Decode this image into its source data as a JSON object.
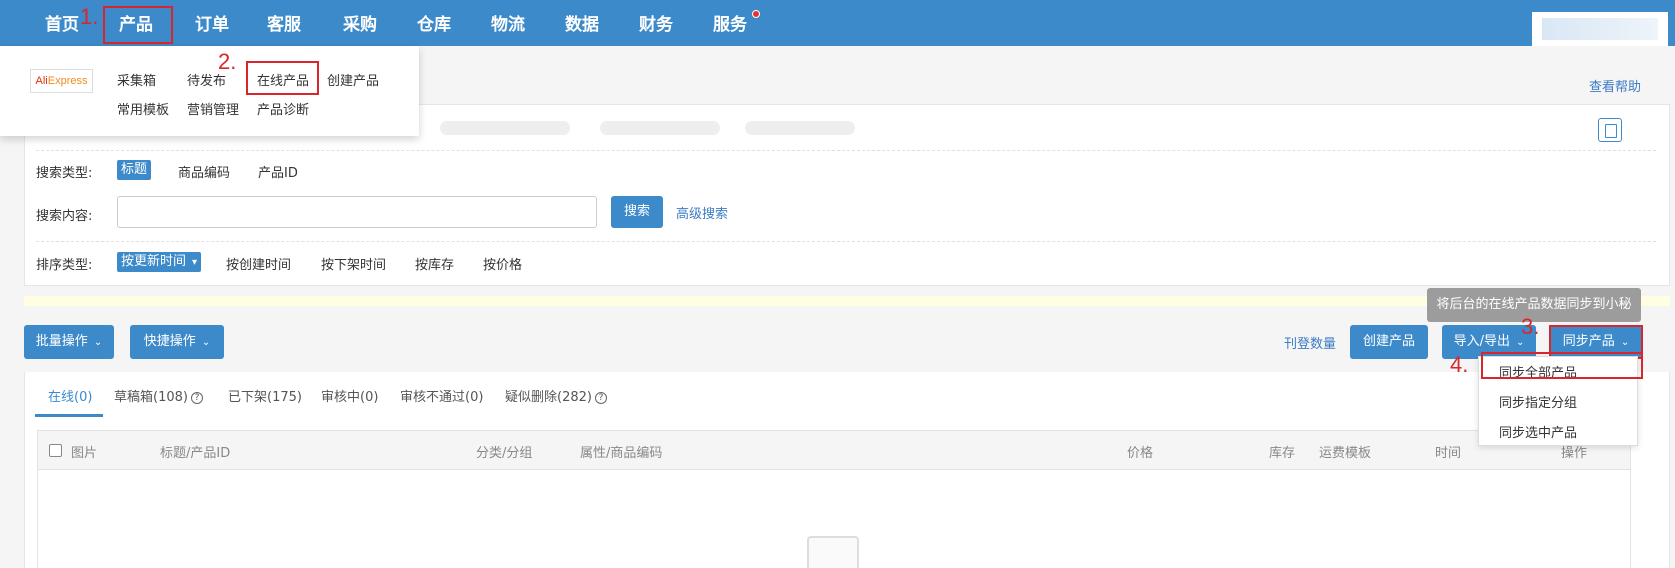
{
  "nav": {
    "items": [
      {
        "label": "首页"
      },
      {
        "label": "产品"
      },
      {
        "label": "订单"
      },
      {
        "label": "客服"
      },
      {
        "label": "采购"
      },
      {
        "label": "仓库"
      },
      {
        "label": "物流"
      },
      {
        "label": "数据"
      },
      {
        "label": "财务"
      },
      {
        "label": "服务"
      }
    ]
  },
  "steps": {
    "s1": "1.",
    "s2": "2.",
    "s3": "3.",
    "s4": "4."
  },
  "product_menu": {
    "logo_ali": "Ali",
    "logo_express": "Express",
    "row1": [
      "采集箱",
      "待发布",
      "在线产品",
      "创建产品"
    ],
    "row2": [
      "常用模板",
      "营销管理",
      "产品诊断"
    ]
  },
  "help_link": "查看帮助",
  "search": {
    "type_label": "搜索类型:",
    "type_options": [
      "标题",
      "商品编码",
      "产品ID"
    ],
    "content_label": "搜索内容:",
    "input_value": "",
    "search_button": "搜索",
    "advanced_link": "高级搜索",
    "sort_label": "排序类型:",
    "sort_selected": "按更新时间",
    "sort_options": [
      "按创建时间",
      "按下架时间",
      "按库存",
      "按价格"
    ]
  },
  "tooltip": "将后台的在线产品数据同步到小秘",
  "toolbar": {
    "batch": "批量操作",
    "quick": "快捷操作",
    "listing_count": "刊登数量",
    "create": "创建产品",
    "import_export": "导入/导出",
    "sync": "同步产品"
  },
  "sync_menu": [
    "同步全部产品",
    "同步指定分组",
    "同步选中产品"
  ],
  "tabs": [
    "在线(0)",
    "草稿箱(108)",
    "已下架(175)",
    "审核中(0)",
    "审核不通过(0)",
    "疑似删除(282)"
  ],
  "help_icon": "?",
  "table": {
    "columns": [
      "图片",
      "标题/产品ID",
      "分类/分组",
      "属性/商品编码",
      "价格",
      "库存",
      "运费模板",
      "时间",
      "操作"
    ]
  },
  "colors": {
    "primary": "#3d8acb",
    "highlight": "#d9262c",
    "tooltip": "#9c9c9c"
  }
}
